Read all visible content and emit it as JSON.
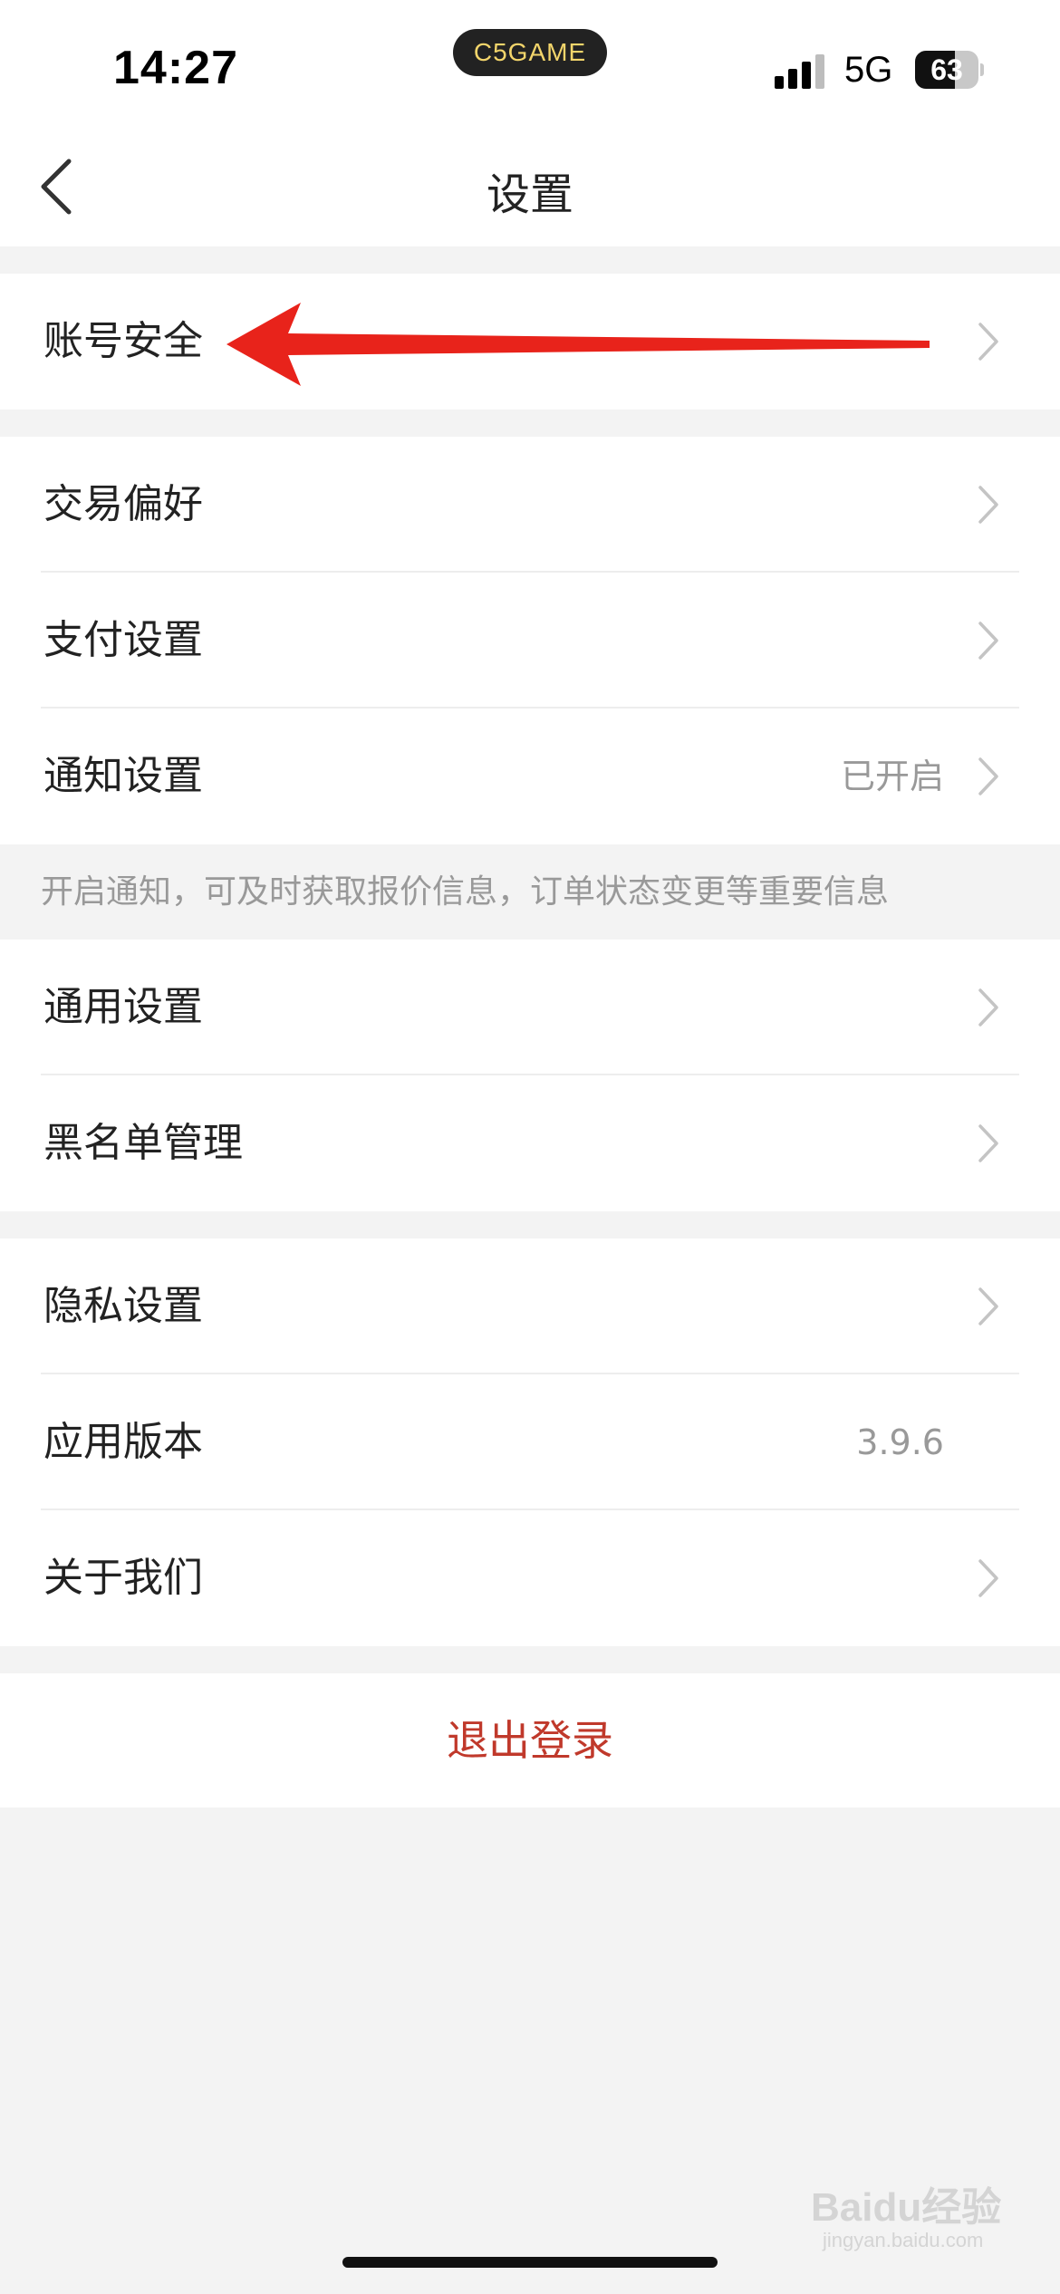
{
  "status_bar": {
    "time": "14:27",
    "app_pill": "C5GAME",
    "network": "5G",
    "battery": "63",
    "battery_level": 0.63
  },
  "nav": {
    "title": "设置"
  },
  "groups": [
    {
      "items": [
        {
          "label": "账号安全"
        }
      ]
    },
    {
      "items": [
        {
          "label": "交易偏好"
        },
        {
          "label": "支付设置"
        },
        {
          "label": "通知设置",
          "value": "已开启"
        }
      ],
      "footnote": "开启通知，可及时获取报价信息，订单状态变更等重要信息"
    },
    {
      "items": [
        {
          "label": "通用设置"
        },
        {
          "label": "黑名单管理"
        }
      ]
    },
    {
      "items": [
        {
          "label": "隐私设置"
        },
        {
          "label": "应用版本",
          "value": "3.9.6"
        },
        {
          "label": "关于我们"
        }
      ]
    }
  ],
  "logout": {
    "label": "退出登录"
  },
  "colors": {
    "logout_text": "#c0392b",
    "annotation_arrow": "#e8231b",
    "page_background": "#f3f3f3"
  },
  "watermark": {
    "text": "Baidu经验",
    "sub": "jingyan.baidu.com"
  }
}
